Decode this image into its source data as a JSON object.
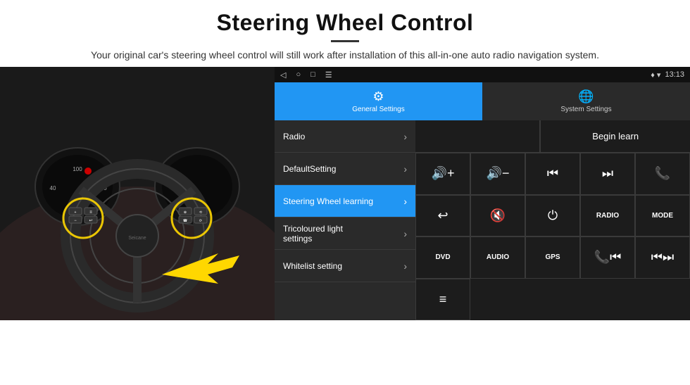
{
  "header": {
    "title": "Steering Wheel Control",
    "subtitle": "Your original car's steering wheel control will still work after installation of this all-in-one auto radio navigation system."
  },
  "status_bar": {
    "time": "13:13",
    "left_icons": [
      "◁",
      "○",
      "□",
      "☰"
    ]
  },
  "tabs": [
    {
      "label": "General Settings",
      "icon": "⚙",
      "active": true
    },
    {
      "label": "System Settings",
      "icon": "🌐",
      "active": false
    }
  ],
  "menu_items": [
    {
      "label": "Radio",
      "active": false
    },
    {
      "label": "DefaultSetting",
      "active": false
    },
    {
      "label": "Steering Wheel learning",
      "active": true
    },
    {
      "label": "Tricoloured light settings",
      "active": false
    },
    {
      "label": "Whitelist setting",
      "active": false
    }
  ],
  "begin_learn_label": "Begin learn",
  "control_buttons": [
    {
      "label": "🔊+",
      "type": "icon"
    },
    {
      "label": "🔊-",
      "type": "icon"
    },
    {
      "label": "⏮",
      "type": "icon"
    },
    {
      "label": "⏭",
      "type": "icon"
    },
    {
      "label": "📞",
      "type": "icon"
    },
    {
      "label": "↩",
      "type": "icon"
    },
    {
      "label": "🔇",
      "type": "icon"
    },
    {
      "label": "⏻",
      "type": "icon"
    },
    {
      "label": "RADIO",
      "type": "text"
    },
    {
      "label": "MODE",
      "type": "text"
    },
    {
      "label": "DVD",
      "type": "text"
    },
    {
      "label": "AUDIO",
      "type": "text"
    },
    {
      "label": "GPS",
      "type": "text"
    },
    {
      "label": "📞⏮",
      "type": "icon"
    },
    {
      "label": "⏮⏭",
      "type": "icon"
    },
    {
      "label": "≡",
      "type": "icon"
    }
  ],
  "colors": {
    "accent": "#2196f3",
    "background": "#1c1c1c",
    "panel": "#2a2a2a",
    "border": "#3a3a3a",
    "text": "#ffffff"
  }
}
